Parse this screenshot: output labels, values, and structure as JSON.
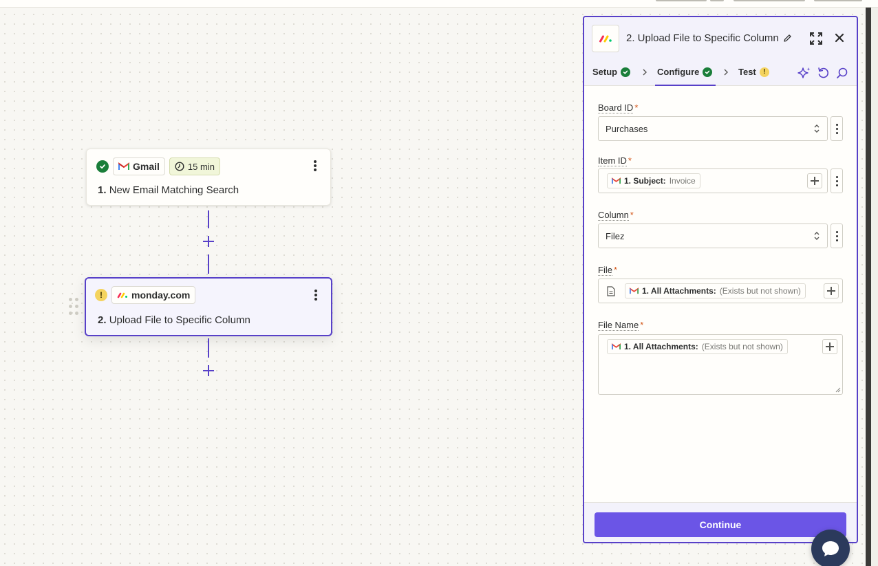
{
  "canvas": {
    "steps": [
      {
        "number": "1.",
        "title": "New Email Matching Search",
        "app_name": "Gmail",
        "interval": "15 min",
        "status": "ok"
      },
      {
        "number": "2.",
        "title": "Upload File to Specific Column",
        "app_name": "monday.com",
        "status": "warning"
      }
    ]
  },
  "panel": {
    "title": "2. Upload File to Specific Column",
    "tabs": [
      {
        "label": "Setup",
        "status": "ok"
      },
      {
        "label": "Configure",
        "status": "ok"
      },
      {
        "label": "Test",
        "status": "warning"
      }
    ],
    "fields": {
      "board_id": {
        "label": "Board ID",
        "required": "*",
        "value": "Purchases"
      },
      "item_id": {
        "label": "Item ID",
        "required": "*",
        "pill_bold": "1. Subject:",
        "pill_muted": "Invoice"
      },
      "column": {
        "label": "Column",
        "required": "*",
        "value": "Filez"
      },
      "file": {
        "label": "File",
        "required": "*",
        "pill_bold": "1. All Attachments:",
        "pill_muted": "(Exists but not shown)"
      },
      "file_name": {
        "label": "File Name",
        "required": "*",
        "pill_bold": "1. All Attachments:",
        "pill_muted": "(Exists but not shown)"
      }
    },
    "continue_label": "Continue"
  },
  "icons": {
    "gmail": "gmail-icon",
    "monday": "monday-icon",
    "clock": "clock-icon",
    "check": "check-circle-icon",
    "warning": "warning-icon",
    "pencil": "pencil-icon",
    "expand": "expand-icon",
    "close": "close-icon",
    "ai": "sparkle-icon",
    "undo": "undo-icon",
    "search": "search-icon",
    "chat": "chat-icon"
  },
  "colors": {
    "accent": "#5740c8",
    "button": "#6b55e6",
    "success": "#1a7e3a",
    "warning": "#f4d35e",
    "required": "#d4581b"
  }
}
